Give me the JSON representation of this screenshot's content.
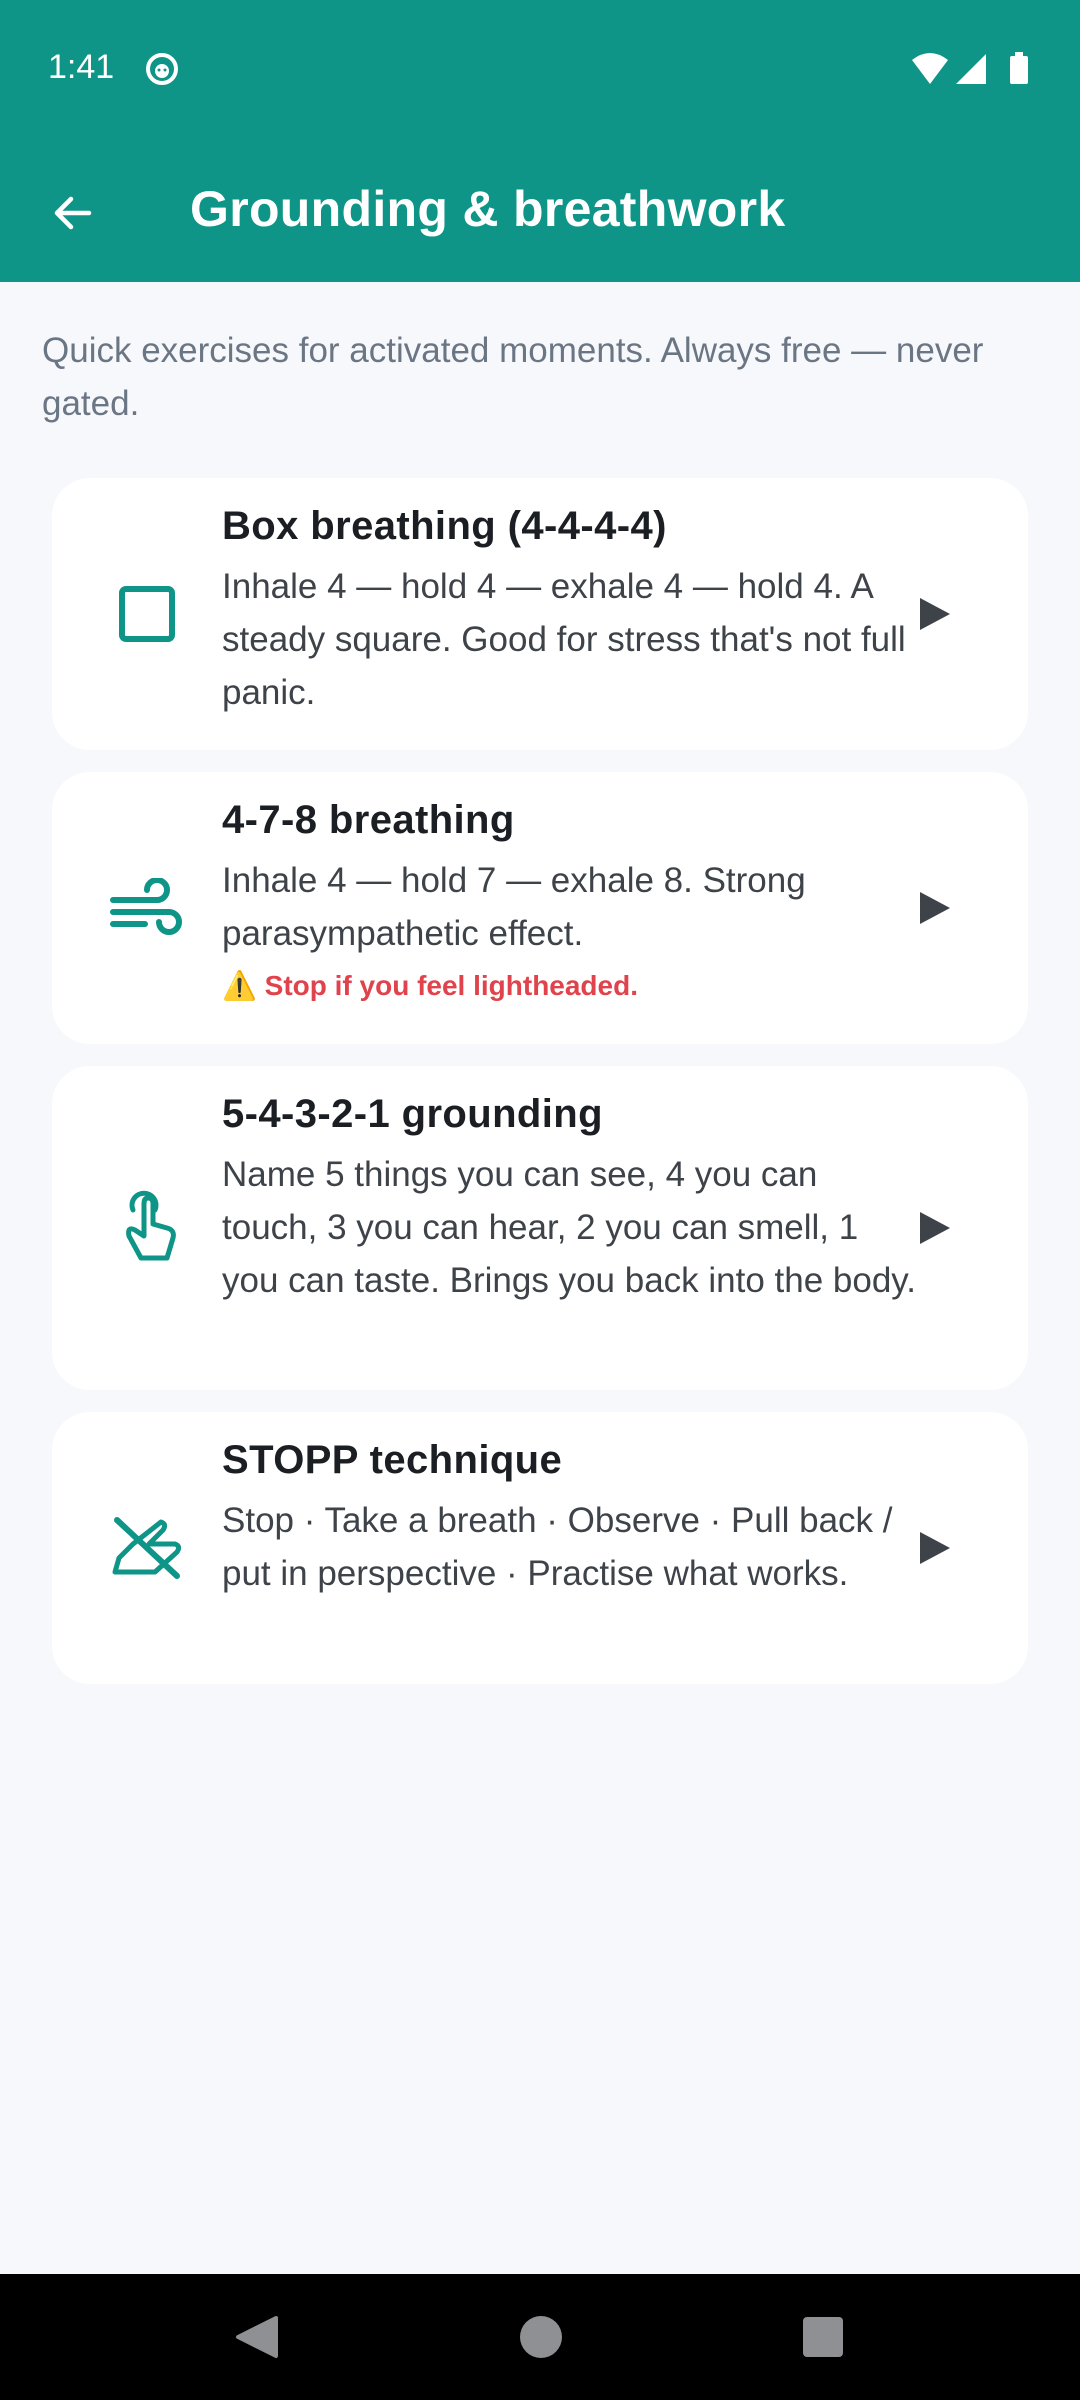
{
  "status_bar": {
    "time": "1:41"
  },
  "app_bar": {
    "title": "Grounding & breathwork"
  },
  "intro_text": "Quick exercises for activated moments. Always free — never gated.",
  "exercises": [
    {
      "title": "Box breathing (4-4-4-4)",
      "description": "Inhale 4 — hold 4 — exhale 4 — hold 4. A steady square. Good for stress that's not full panic.",
      "warning": "",
      "icon": "square-outline-icon"
    },
    {
      "title": "4-7-8 breathing",
      "description": "Inhale 4 — hold 7 — exhale 8. Strong parasympathetic effect.",
      "warning": "⚠️ Stop if you feel lightheaded.",
      "icon": "air-wind-icon"
    },
    {
      "title": "5-4-3-2-1 grounding",
      "description": "Name 5 things you can see, 4 you can touch, 3 you can hear, 2 you can smell, 1 you can taste. Brings you back into the body.",
      "warning": "",
      "icon": "touch-hand-icon"
    },
    {
      "title": "STOPP technique",
      "description": "Stop · Take a breath · Observe · Pull back / put in perspective · Practise what works.",
      "warning": "",
      "icon": "do-not-touch-icon"
    }
  ],
  "colors": {
    "primary": "#0e9587",
    "warning": "#e0434b",
    "background": "#f7f8fb",
    "card": "#ffffff"
  }
}
